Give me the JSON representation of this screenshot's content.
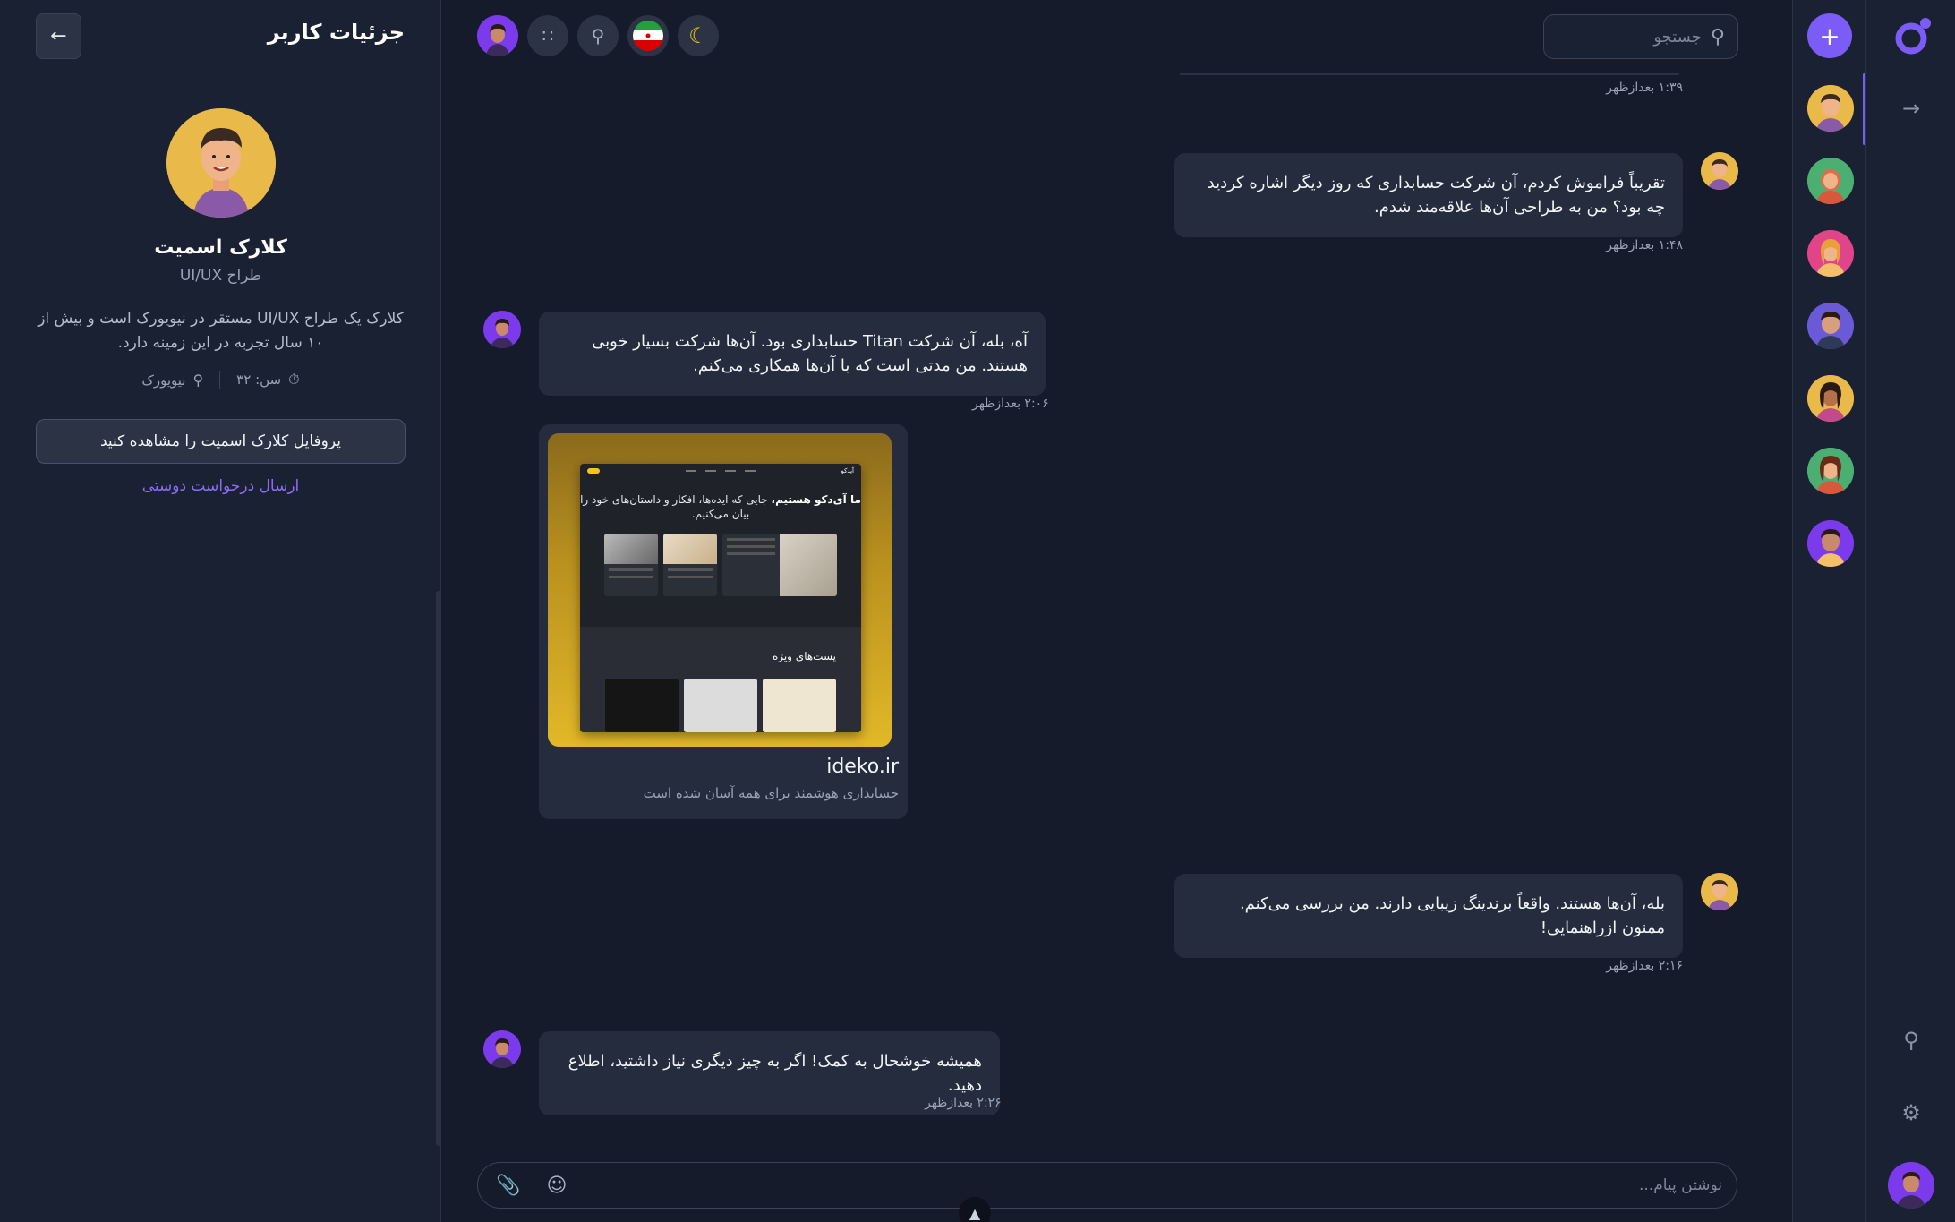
{
  "details": {
    "title": "جزئیات کاربر",
    "name": "کلارک اسمیت",
    "role": "طراح UI/UX",
    "bio": "کلارک یک طراح UI/UX مستقر در نیویورک است و بیش از ۱۰ سال تجربه در این زمینه دارد.",
    "age": "سن: ۳۲",
    "location": "نیویورک",
    "profile_button": "پروفایل کلارک اسمیت را مشاهده کنید",
    "friend_request": "ارسال درخواست دوستی"
  },
  "topbar": {
    "search_placeholder": "جستجو"
  },
  "messages": {
    "first_time": "۱:۳۹ بعدازظهر",
    "m1_text": "تقریباً فراموش کردم، آن شرکت حسابداری که روز دیگر اشاره کردید چه بود؟ من به طراحی آن‌ها علاقه‌مند شدم.",
    "m1_time": "۱:۴۸ بعدازظهر",
    "m2_text": "آه، بله، آن شرکت Titan حسابداری بود. آن‌ها شرکت بسیار خوبی هستند. من مدتی است که با آن‌ها همکاری می‌کنم.",
    "m2_time": "۲:۰۶ بعدازظهر",
    "m3_text": "بله، آن‌ها هستند. واقعاً برندینگ زیبایی دارند. من بررسی می‌کنم. ممنون ازراهنمایی!",
    "m3_time": "۲:۱۶ بعدازظهر",
    "m4_text": "همیشه خوشحال به کمک! اگر به چیز دیگری نیاز داشتید، اطلاع دهید.",
    "m4_time": "۲:۲۶ بعدازظهر"
  },
  "link_preview": {
    "site": "ideko.ir",
    "description": "حسابداری هوشمند برای همه آسان شده است",
    "hero_bold": "ما آی‌دکو هستیم،",
    "hero_text": " جایی که ایده‌ها، افکار و داستان‌های خود را بیان می‌کنیم.",
    "logo": "آیدکو",
    "section_title": "پست‌های ویژه"
  },
  "composer": {
    "placeholder": "نوشتن پیام..."
  },
  "icons": {
    "accent": "#7c5cf6",
    "rail": [
      "logo-icon",
      "arrow-right-icon",
      "search-icon",
      "settings-icon"
    ]
  }
}
